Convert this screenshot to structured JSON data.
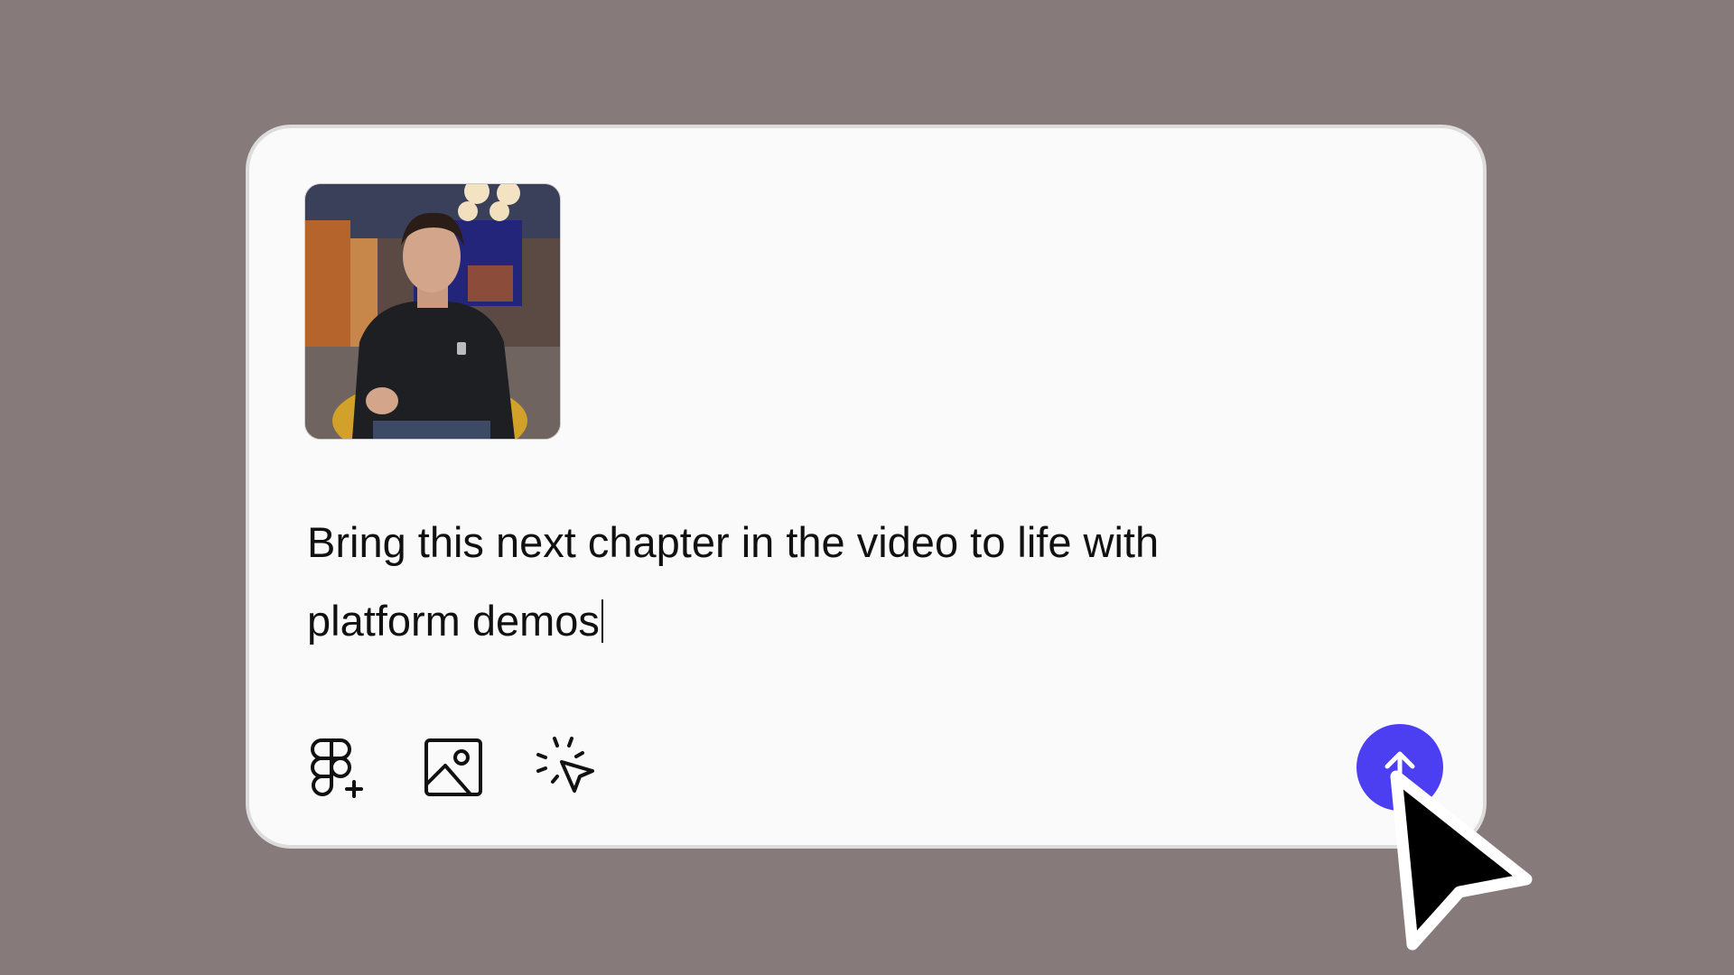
{
  "prompt": {
    "text_line_1": "Bring this next chapter in the video to life with",
    "text_line_2": "platform demos"
  },
  "toolbar": {
    "icons": [
      "figma-add-icon",
      "image-icon",
      "sparkle-cursor-icon"
    ]
  },
  "colors": {
    "background": "#877a7b",
    "card": "#fafafa",
    "accent": "#4c3ff2"
  }
}
